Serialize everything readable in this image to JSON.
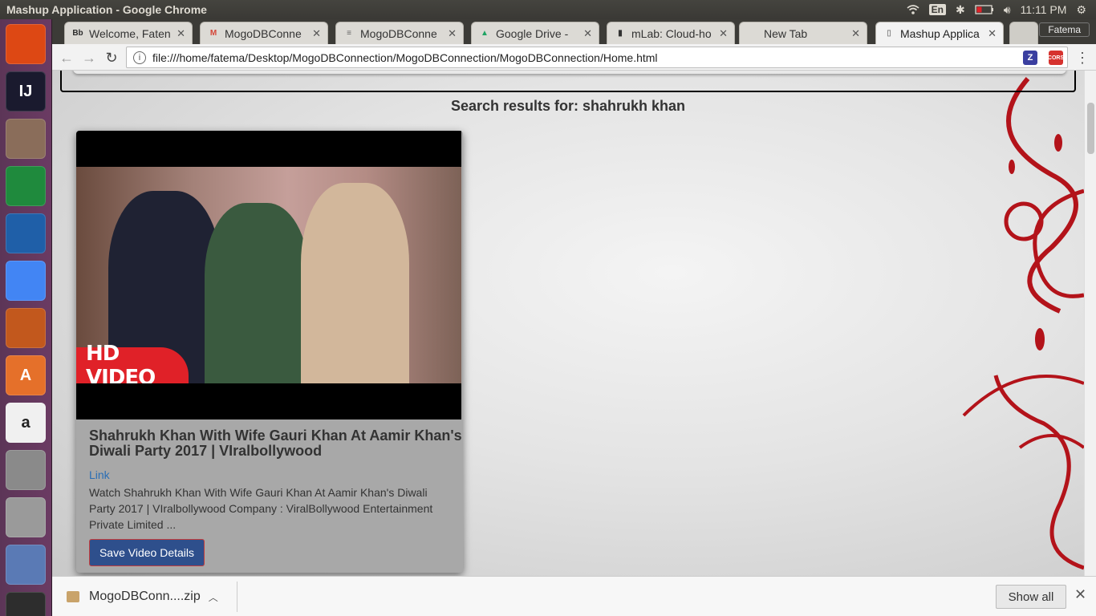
{
  "system": {
    "window_title": "Mashup Application - Google Chrome",
    "language": "En",
    "clock": "11:11 PM"
  },
  "launcher": {
    "items": [
      {
        "name": "ubuntu-dash",
        "label": "",
        "color": "#dd4814"
      },
      {
        "name": "intellij",
        "label": "IJ",
        "color": "#1a1a2e"
      },
      {
        "name": "files",
        "label": "",
        "color": "#8a6d5a"
      },
      {
        "name": "calc",
        "label": "",
        "color": "#1f8a3d"
      },
      {
        "name": "writer",
        "label": "",
        "color": "#1f5fa8"
      },
      {
        "name": "chrome",
        "label": "",
        "color": "#4285f4"
      },
      {
        "name": "impress",
        "label": "",
        "color": "#c2581d"
      },
      {
        "name": "software-center",
        "label": "A",
        "color": "#e5702a"
      },
      {
        "name": "amazon",
        "label": "a",
        "color": "#f0f0f0"
      },
      {
        "name": "settings",
        "label": "",
        "color": "#8a8a8a"
      },
      {
        "name": "disk",
        "label": "",
        "color": "#9a9a9a"
      },
      {
        "name": "scanner",
        "label": "",
        "color": "#5a7ab5"
      },
      {
        "name": "terminal",
        "label": "",
        "color": "#2d2d2d"
      }
    ]
  },
  "browser": {
    "user": "Fatema",
    "tabs": [
      {
        "label": "Welcome, Faten",
        "favicon": "Bb",
        "favcolor": "#2b2b2b"
      },
      {
        "label": "MogoDBConne",
        "favicon": "M",
        "favcolor": "#d44638"
      },
      {
        "label": "MogoDBConne",
        "favicon": "≡",
        "favcolor": "#666666"
      },
      {
        "label": "Google Drive -",
        "favicon": "▲",
        "favcolor": "#1fa463"
      },
      {
        "label": "mLab: Cloud-ho",
        "favicon": "▮",
        "favcolor": "#333333"
      },
      {
        "label": "New Tab",
        "favicon": "",
        "favcolor": ""
      },
      {
        "label": "Mashup Applica",
        "favicon": "▯",
        "favcolor": "#888888"
      }
    ],
    "url": "file:///home/fatema/Desktop/MogoDBConnection/MogoDBConnection/MogoDBConnection/Home.html"
  },
  "page": {
    "results_heading": "Search results for: shahrukh khan",
    "card": {
      "badge": "HD VIDEO",
      "title": "Shahrukh Khan With Wife Gauri Khan At Aamir Khan's Diwali Party 2017 | VIralbollywood",
      "link_text": "Link",
      "description": "Watch Shahrukh Khan With Wife Gauri Khan At Aamir Khan's Diwali Party 2017 | VIralbollywood Company : ViralBollywood Entertainment Private Limited ...",
      "save_label": "Save Video Details"
    }
  },
  "downloads": {
    "file": "MogoDBConn....zip",
    "show_all": "Show all"
  }
}
